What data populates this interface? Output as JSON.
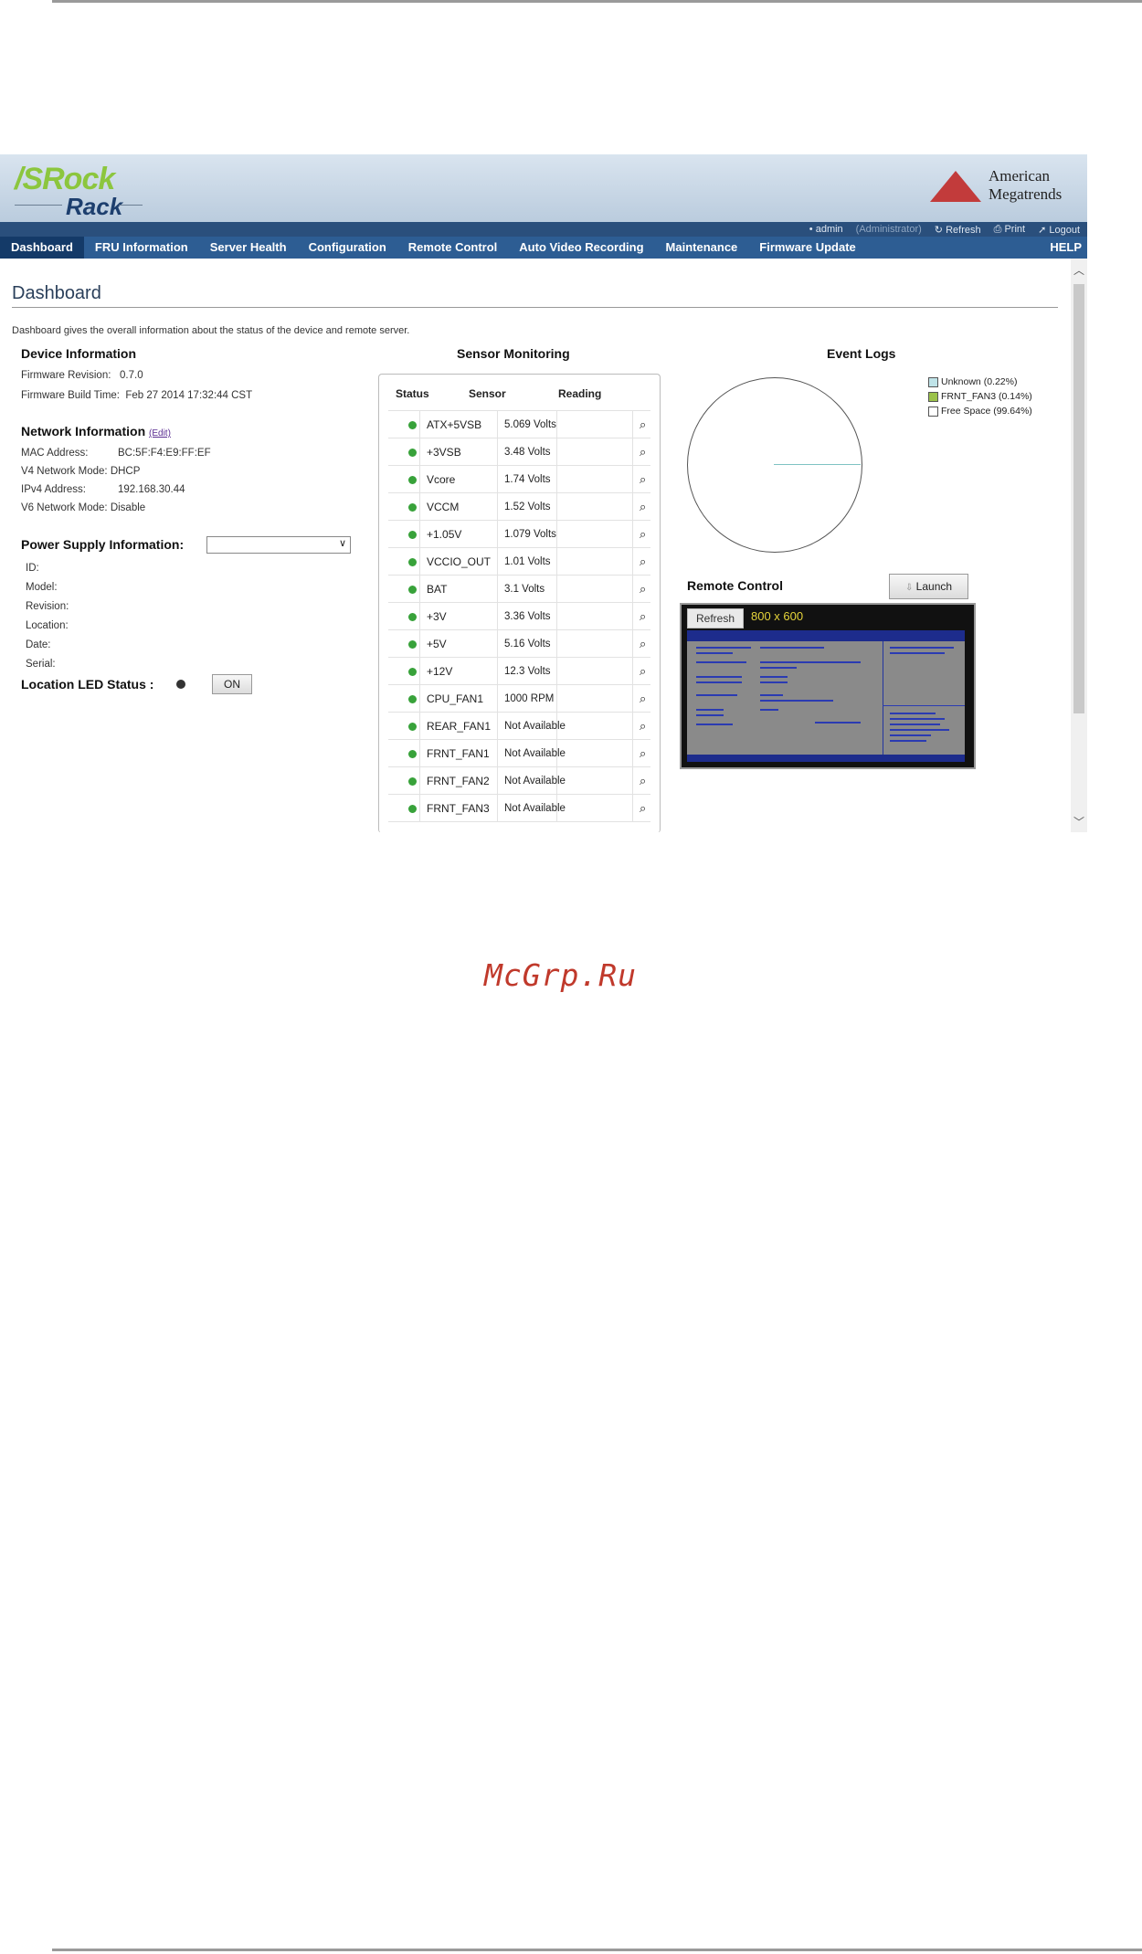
{
  "header": {
    "brand": "/SRock",
    "brand_sub": "Rack",
    "vendor_line1": "American",
    "vendor_line2": "Megatrends"
  },
  "utility_bar": {
    "user": "• admin",
    "role": "(Administrator)",
    "refresh": "↻ Refresh",
    "print": "⎙ Print",
    "logout": "➚ Logout"
  },
  "nav": {
    "items": [
      "Dashboard",
      "FRU Information",
      "Server Health",
      "Configuration",
      "Remote Control",
      "Auto Video Recording",
      "Maintenance",
      "Firmware Update"
    ],
    "help": "HELP"
  },
  "page": {
    "title": "Dashboard",
    "description": "Dashboard gives the overall information about the status of the device and remote server."
  },
  "device_info": {
    "heading": "Device Information",
    "firmware_revision_label": "Firmware Revision:",
    "firmware_revision": "0.7.0",
    "firmware_build_label": "Firmware Build Time:",
    "firmware_build": "Feb 27 2014 17:32:44 CST"
  },
  "network_info": {
    "heading": "Network Information",
    "edit": "(Edit)",
    "mac_label": "MAC Address:",
    "mac": "BC:5F:F4:E9:FF:EF",
    "v4_mode_label": "V4 Network Mode:",
    "v4_mode": "DHCP",
    "ipv4_label": "IPv4 Address:",
    "ipv4": "192.168.30.44",
    "v6_mode_label": "V6 Network Mode:",
    "v6_mode": "Disable"
  },
  "power_supply": {
    "heading": "Power Supply Information:",
    "selected": "",
    "fields": [
      "ID:",
      "Model:",
      "Revision:",
      "Location:",
      "Date:",
      "Serial:"
    ]
  },
  "location_led": {
    "label": "Location LED Status :",
    "button": "ON"
  },
  "sensor_monitoring": {
    "heading": "Sensor Monitoring",
    "columns": [
      "Status",
      "Sensor",
      "Reading"
    ],
    "status_color": "#38a23a",
    "rows": [
      {
        "sensor": "ATX+5VSB",
        "reading": "5.069 Volts"
      },
      {
        "sensor": "+3VSB",
        "reading": "3.48 Volts"
      },
      {
        "sensor": "Vcore",
        "reading": "1.74 Volts"
      },
      {
        "sensor": "VCCM",
        "reading": "1.52 Volts"
      },
      {
        "sensor": "+1.05V",
        "reading": "1.079 Volts"
      },
      {
        "sensor": "VCCIO_OUT",
        "reading": "1.01 Volts"
      },
      {
        "sensor": "BAT",
        "reading": "3.1 Volts"
      },
      {
        "sensor": "+3V",
        "reading": "3.36 Volts"
      },
      {
        "sensor": "+5V",
        "reading": "5.16 Volts"
      },
      {
        "sensor": "+12V",
        "reading": "12.3 Volts"
      },
      {
        "sensor": "CPU_FAN1",
        "reading": "1000 RPM"
      },
      {
        "sensor": "REAR_FAN1",
        "reading": "Not Available"
      },
      {
        "sensor": "FRNT_FAN1",
        "reading": "Not Available"
      },
      {
        "sensor": "FRNT_FAN2",
        "reading": "Not Available"
      },
      {
        "sensor": "FRNT_FAN3",
        "reading": "Not Available"
      }
    ]
  },
  "event_logs": {
    "heading": "Event Logs",
    "legend": [
      {
        "label": "Unknown (0.22%)",
        "color": "#bfe3e8",
        "percent": 0.22
      },
      {
        "label": "FRNT_FAN3 (0.14%)",
        "color": "#9bc24a",
        "percent": 0.14
      },
      {
        "label": "Free Space (99.64%)",
        "color": "#ffffff",
        "percent": 99.64
      }
    ]
  },
  "remote_control": {
    "heading": "Remote Control",
    "launch": "Launch",
    "refresh": "Refresh",
    "resolution": "800 x 600"
  },
  "watermark": "McGrp.Ru",
  "colors": {
    "nav_bg": "#2d5d93",
    "nav_active": "#143a68",
    "brand_green": "#8cc63e",
    "watermark": "#c0392b"
  }
}
